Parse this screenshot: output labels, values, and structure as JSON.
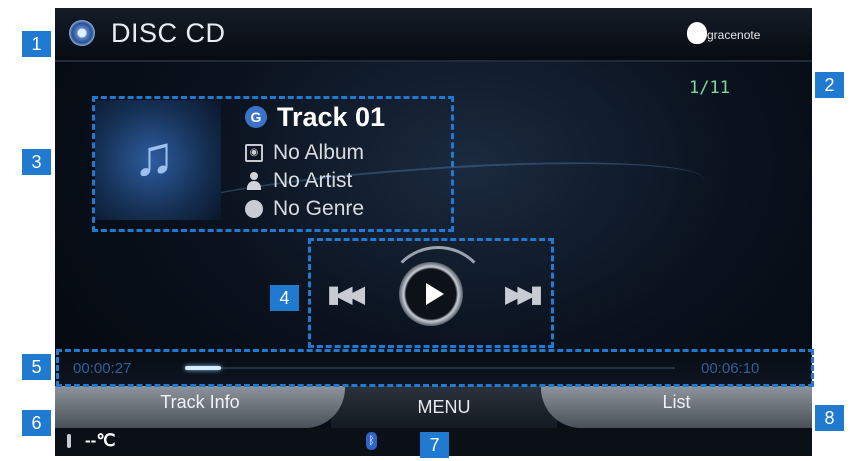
{
  "header": {
    "title": "DISC CD",
    "brand": "gracenote"
  },
  "track_counter": "1/11",
  "track_info": {
    "track": "Track 01",
    "album": "No Album",
    "artist": "No Artist",
    "genre": "No Genre"
  },
  "playback": {
    "elapsed": "00:00:27",
    "total": "00:06:10",
    "progress": 0.073
  },
  "tabs": {
    "left": "Track Info",
    "middle": "MENU",
    "right": "List"
  },
  "status": {
    "temperature": "--℃"
  },
  "callouts": [
    "1",
    "2",
    "3",
    "4",
    "5",
    "6",
    "7",
    "8"
  ],
  "colors": {
    "callout": "#1f7ad0",
    "counter": "#7fd9a3",
    "time": "#2f5f9a"
  },
  "icons": [
    "disc-icon",
    "gracenote-logo-icon",
    "music-note-icon",
    "track-icon",
    "album-icon",
    "artist-icon",
    "genre-icon",
    "previous-track-icon",
    "play-icon",
    "next-track-icon",
    "thermometer-icon",
    "bluetooth-icon"
  ]
}
